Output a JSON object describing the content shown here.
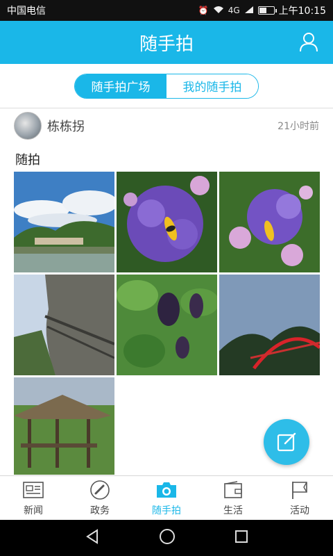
{
  "status_bar": {
    "carrier": "中国电信",
    "network": "4G",
    "time": "上午10:15",
    "battery_level": 0.45
  },
  "header": {
    "title": "随手拍"
  },
  "tabs": [
    {
      "label": "随手拍广场",
      "active": true
    },
    {
      "label": "我的随手拍",
      "active": false
    }
  ],
  "post": {
    "author": "栋栋拐",
    "time_ago": "21小时前",
    "text": "随拍",
    "photos": [
      {
        "subject": "mountain-lake-landscape"
      },
      {
        "subject": "purple-flowers-bee"
      },
      {
        "subject": "purple-flowers-bee-closeup"
      },
      {
        "subject": "cliff-walkway"
      },
      {
        "subject": "grapes-vine"
      },
      {
        "subject": "red-arch-bridge"
      },
      {
        "subject": "thatched-pavilion"
      }
    ]
  },
  "bottom_nav": [
    {
      "label": "新闻",
      "icon": "newspaper-icon",
      "active": false
    },
    {
      "label": "政务",
      "icon": "link-icon",
      "active": false
    },
    {
      "label": "随手拍",
      "icon": "camera-icon",
      "active": true
    },
    {
      "label": "生活",
      "icon": "wallet-icon",
      "active": false
    },
    {
      "label": "活动",
      "icon": "flag-icon",
      "active": false
    }
  ],
  "colors": {
    "accent": "#1ab7e8",
    "fab": "#2ebde8"
  }
}
